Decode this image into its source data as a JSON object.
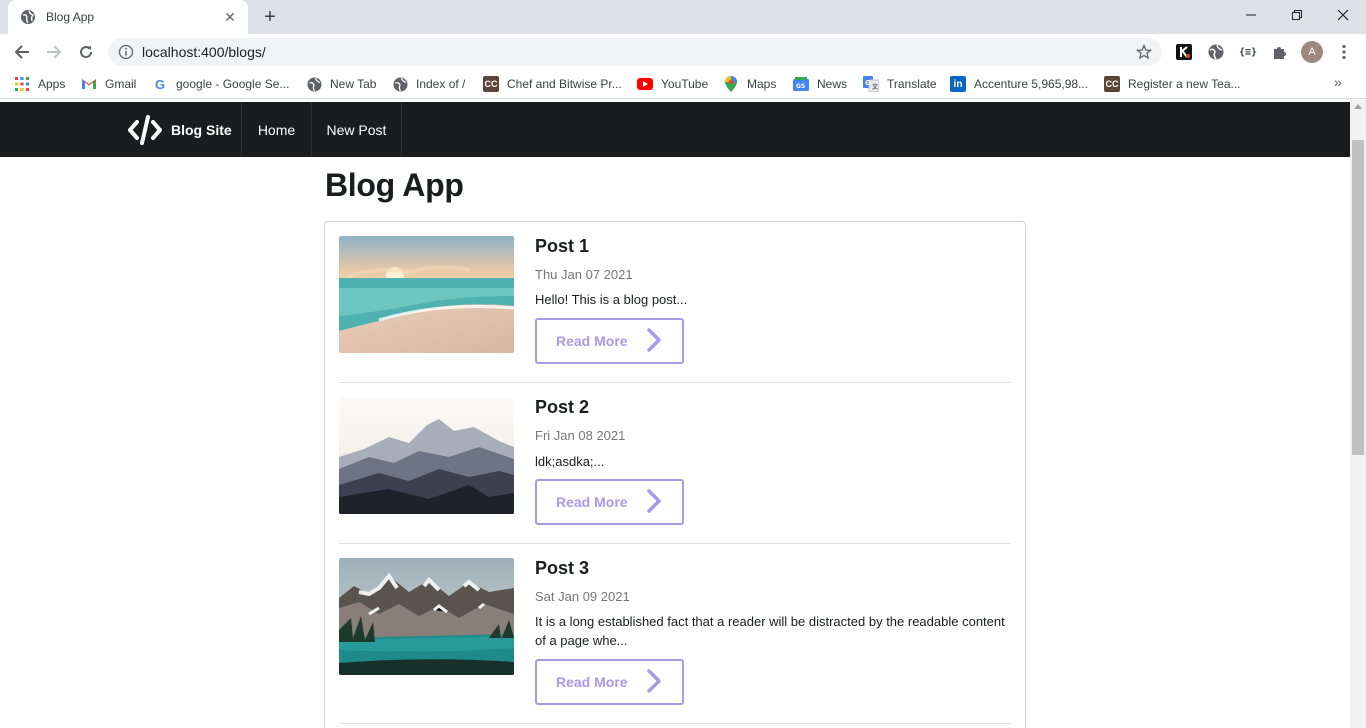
{
  "browser": {
    "tab_title": "Blog App",
    "url": "localhost:400/blogs/",
    "avatar_letter": "A",
    "bookmarks": [
      {
        "label": "Apps",
        "icon": "apps-grid-icon"
      },
      {
        "label": "Gmail",
        "icon": "gmail-icon"
      },
      {
        "label": "google - Google Se...",
        "icon": "google-icon"
      },
      {
        "label": "New Tab",
        "icon": "globe-icon"
      },
      {
        "label": "Index of /",
        "icon": "globe-icon"
      },
      {
        "label": "Chef and Bitwise Pr...",
        "icon": "codechef-icon"
      },
      {
        "label": "YouTube",
        "icon": "youtube-icon"
      },
      {
        "label": "Maps",
        "icon": "maps-icon"
      },
      {
        "label": "News",
        "icon": "news-icon"
      },
      {
        "label": "Translate",
        "icon": "translate-icon"
      },
      {
        "label": "Accenture 5,965,98...",
        "icon": "linkedin-icon"
      },
      {
        "label": "Register a new Tea...",
        "icon": "codechef-icon"
      }
    ],
    "more_bookmarks": "»"
  },
  "site": {
    "brand": "Blog Site",
    "nav": {
      "home": "Home",
      "new_post": "New Post"
    },
    "page_title": "Blog App",
    "read_more_label": "Read More",
    "posts": [
      {
        "title": "Post 1",
        "date": "Thu Jan 07 2021",
        "excerpt": "Hello! This is a blog post...",
        "image": "beach-sunset"
      },
      {
        "title": "Post 2",
        "date": "Fri Jan 08 2021",
        "excerpt": "ldk;asdka;...",
        "image": "misty-mountains"
      },
      {
        "title": "Post 3",
        "date": "Sat Jan 09 2021",
        "excerpt": "It is a long established fact that a reader will be distracted by the readable content of a page whe...",
        "image": "mountain-lake"
      }
    ]
  },
  "colors": {
    "navbar": "#1b1c1d",
    "read_more_accent": "#a99ae8"
  }
}
